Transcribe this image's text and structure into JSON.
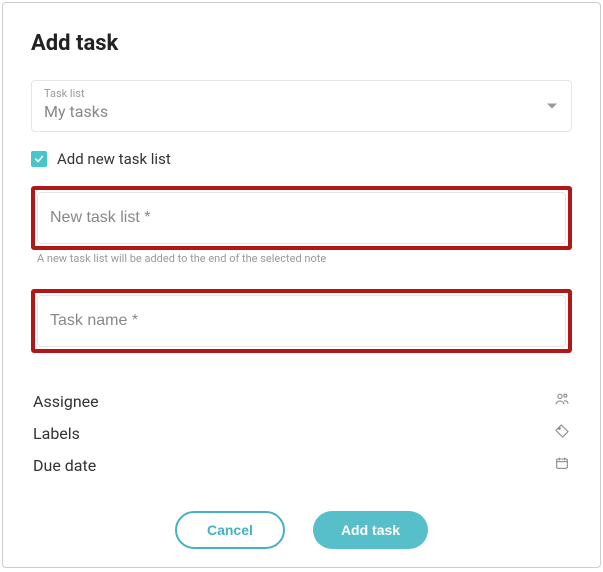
{
  "dialog": {
    "title": "Add task"
  },
  "taskListSelect": {
    "label": "Task list",
    "value": "My tasks"
  },
  "addNewListCheckbox": {
    "checked": true,
    "label": "Add new task list"
  },
  "newTaskListInput": {
    "placeholder": "New task list *",
    "helper": "A new task list will be added to the end of the selected note"
  },
  "taskNameInput": {
    "placeholder": "Task name *"
  },
  "meta": {
    "assignee": "Assignee",
    "labels": "Labels",
    "dueDate": "Due date"
  },
  "buttons": {
    "cancel": "Cancel",
    "submit": "Add task"
  }
}
